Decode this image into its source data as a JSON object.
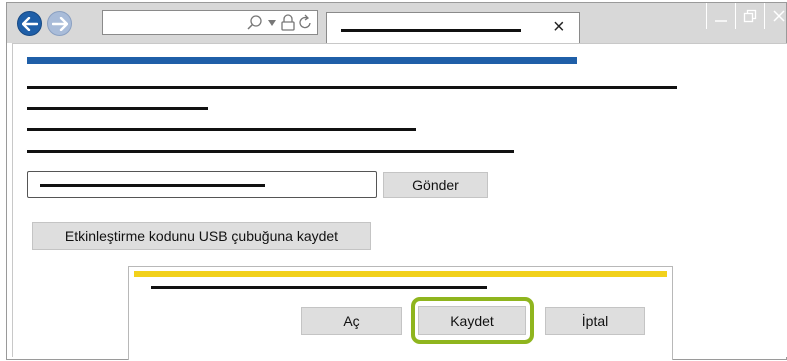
{
  "browser": {
    "address_icons": [
      "search-icon",
      "dropdown-arrow-icon",
      "lock-icon",
      "refresh-icon"
    ],
    "tab": {
      "close_symbol": "×"
    },
    "window_controls": [
      "minimize-icon",
      "restore-icon",
      "close-icon"
    ]
  },
  "page": {
    "submit_label": "Gönder",
    "save_usb_label": "Etkinleştirme kodunu USB çubuğuna kaydet"
  },
  "dialog": {
    "open_label": "Aç",
    "save_label": "Kaydet",
    "cancel_label": "İptal"
  },
  "colors": {
    "toolbar": "#d8d8d8",
    "accent_blue": "#1f5fa8",
    "dialog_yellow": "#f2d11b",
    "highlight_green": "#8fb51e",
    "button_gray": "#dedede"
  }
}
